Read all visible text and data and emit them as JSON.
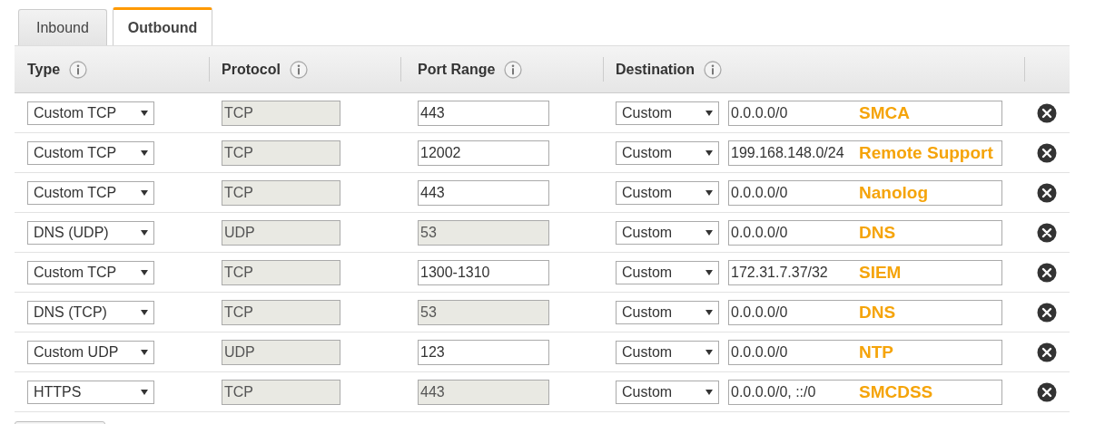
{
  "tabs": [
    {
      "label": "Inbound",
      "selected": false
    },
    {
      "label": "Outbound",
      "selected": true
    }
  ],
  "table": {
    "columns": [
      "Type",
      "Protocol",
      "Port Range",
      "Destination"
    ],
    "rows": [
      {
        "type": "Custom TCP",
        "protocol": {
          "value": "TCP",
          "disabled": true
        },
        "port_range": {
          "value": "443",
          "disabled": false
        },
        "destination_type": "Custom",
        "destination": "0.0.0.0/0",
        "annotation": "SMCA"
      },
      {
        "type": "Custom TCP",
        "protocol": {
          "value": "TCP",
          "disabled": true
        },
        "port_range": {
          "value": "12002",
          "disabled": false
        },
        "destination_type": "Custom",
        "destination": "199.168.148.0/24",
        "annotation": "Remote Support"
      },
      {
        "type": "Custom TCP",
        "protocol": {
          "value": "TCP",
          "disabled": true
        },
        "port_range": {
          "value": "443",
          "disabled": false
        },
        "destination_type": "Custom",
        "destination": "0.0.0.0/0",
        "annotation": "Nanolog"
      },
      {
        "type": "DNS (UDP)",
        "protocol": {
          "value": "UDP",
          "disabled": true
        },
        "port_range": {
          "value": "53",
          "disabled": true
        },
        "destination_type": "Custom",
        "destination": "0.0.0.0/0",
        "annotation": "DNS"
      },
      {
        "type": "Custom TCP",
        "protocol": {
          "value": "TCP",
          "disabled": true
        },
        "port_range": {
          "value": "1300-1310",
          "disabled": false
        },
        "destination_type": "Custom",
        "destination": "172.31.7.37/32",
        "annotation": "SIEM"
      },
      {
        "type": "DNS (TCP)",
        "protocol": {
          "value": "TCP",
          "disabled": true
        },
        "port_range": {
          "value": "53",
          "disabled": true
        },
        "destination_type": "Custom",
        "destination": "0.0.0.0/0",
        "annotation": "DNS"
      },
      {
        "type": "Custom UDP",
        "protocol": {
          "value": "UDP",
          "disabled": true
        },
        "port_range": {
          "value": "123",
          "disabled": false
        },
        "destination_type": "Custom",
        "destination": "0.0.0.0/0",
        "annotation": "NTP"
      },
      {
        "type": "HTTPS",
        "protocol": {
          "value": "TCP",
          "disabled": true
        },
        "port_range": {
          "value": "443",
          "disabled": true
        },
        "destination_type": "Custom",
        "destination": "0.0.0.0/0, ::/0",
        "annotation": "SMCDSS"
      }
    ]
  }
}
